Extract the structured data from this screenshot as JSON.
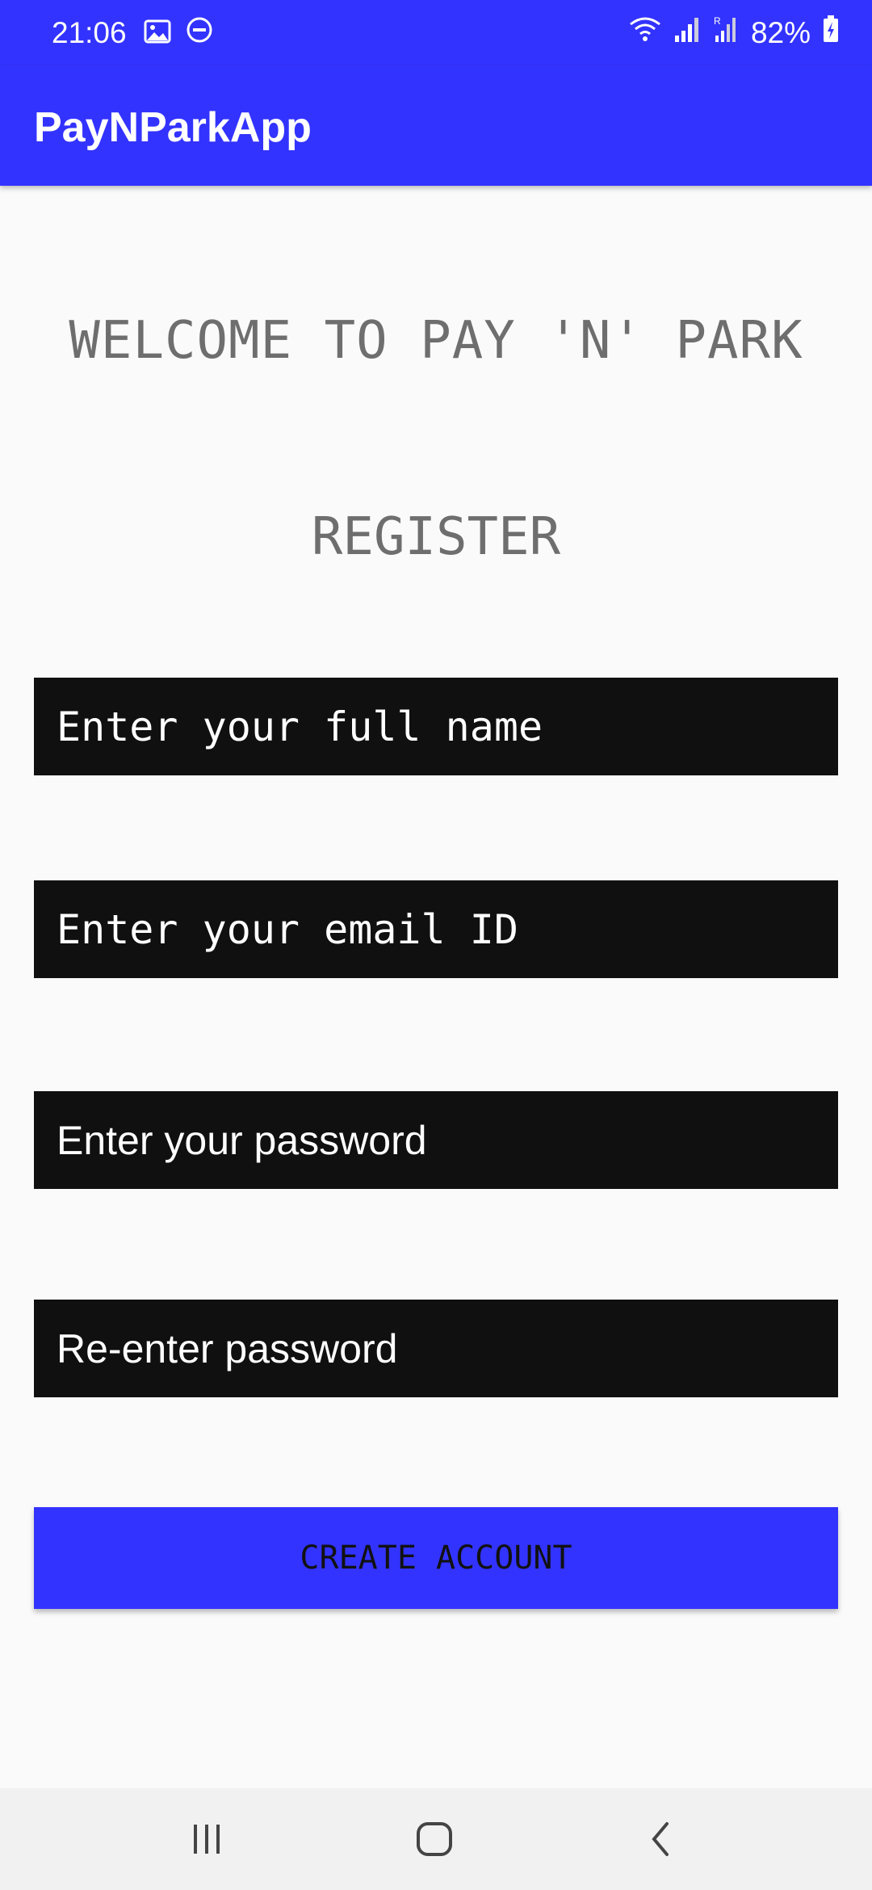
{
  "status_bar": {
    "time": "21:06",
    "battery": "82%",
    "icons_left": [
      "image-icon",
      "dnd-icon"
    ],
    "icons_right": [
      "wifi-icon",
      "signal-icon",
      "signal-roaming-icon",
      "battery-charging-icon"
    ]
  },
  "app_bar": {
    "title": "PayNParkApp",
    "color": "#3333ff"
  },
  "main": {
    "welcome": "WELCOME TO PAY 'N' PARK",
    "heading": "REGISTER",
    "fields": {
      "full_name": "Enter your full name",
      "email": "Enter your email ID",
      "password": "Enter your password",
      "reenter_password": "Re-enter password"
    },
    "create_account_label": "CREATE ACCOUNT"
  },
  "nav_bar": {
    "buttons": [
      "recents-icon",
      "home-icon",
      "back-icon"
    ]
  }
}
